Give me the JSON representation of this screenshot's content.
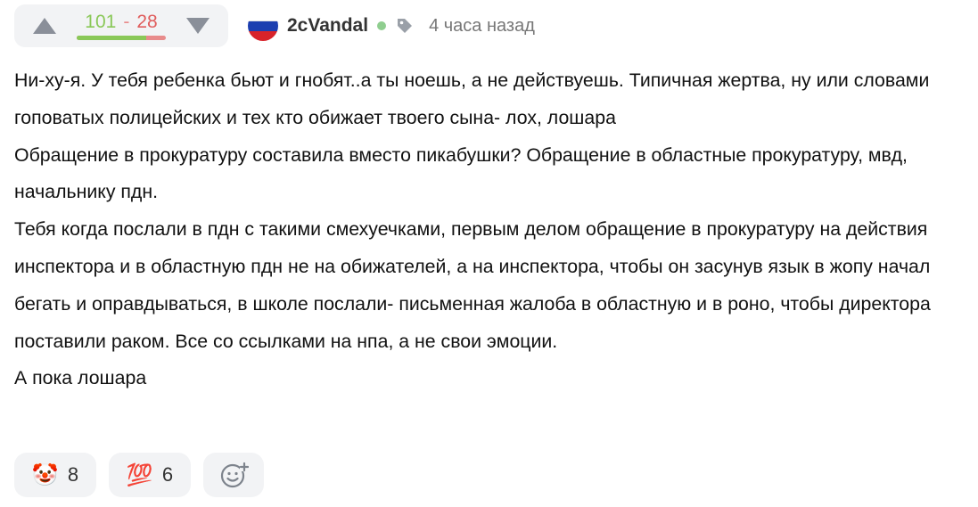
{
  "rating": {
    "positive": "101",
    "separator": "-",
    "negative": "28",
    "positive_ratio": 0.783
  },
  "author": {
    "username": "2cVandal",
    "time": "4 часа назад"
  },
  "comment": {
    "paragraphs": [
      "Ни-ху-я. У тебя ребенка бьют и гнобят..а ты ноешь, а не действуешь. Типичная жертва, ну или словами гоповатых полицейских и тех кто обижает твоего сына- лох, лошара",
      "Обращение в прокуратуру составила вместо пикабушки? Обращение в областные прокуратуру, мвд, начальнику пдн.",
      "Тебя когда послали в пдн с такими смехуечками, первым делом обращение в прокуратуру на действия инспектора и в областную пдн не на обижателей, а на инспектора, чтобы он засунув язык в жопу начал бегать и оправдываться, в школе послали- письменная жалоба в областную и в роно, чтобы директора поставили раком. Все со ссылками на нпа, а не свои эмоции.",
      "А пока лошара"
    ]
  },
  "reactions": [
    {
      "icon": "clown-face-icon",
      "emoji": "🤡",
      "count": "8"
    },
    {
      "icon": "hundred-points-icon",
      "emoji": "💯",
      "count": "6"
    }
  ],
  "colors": {
    "positive": "#8ac858",
    "negative": "#e05d5d",
    "online": "#8fce8f",
    "panel": "#f2f3f5"
  }
}
